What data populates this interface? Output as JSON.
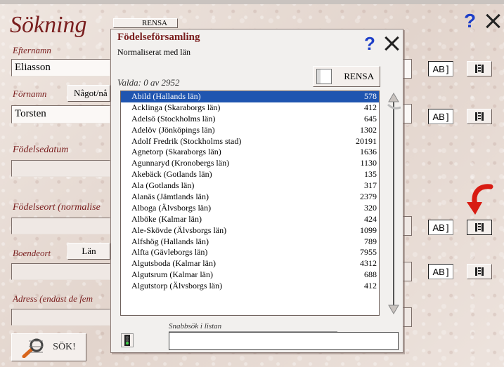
{
  "window": {
    "title": "Sökning"
  },
  "form": {
    "lastname_label": "Efternamn",
    "lastname_value": "Eliasson",
    "firstname_label": "Förnamn",
    "firstname_mode": "Något/nå",
    "firstname_value": "Torsten",
    "birthdate_label": "Födelsedatum",
    "birthplace_label": "Födelseort (normalise",
    "residence_label": "Boendeort",
    "residence_scope": "Län",
    "address_label": "Adress (endast de fem",
    "clear_partial": "RENSA",
    "ab_label": "AB",
    "search_label": "SÖK!"
  },
  "dialog": {
    "title": "Födelseförsamling",
    "subtitle": "Normaliserat med län",
    "selected_count": "Valda: 0 av 2952",
    "clear_label": "RENSA",
    "quicksearch_label": "Snabbsök i listan",
    "quicksearch_value": "",
    "items": [
      {
        "name": "Abild (Hallands län)",
        "count": "578"
      },
      {
        "name": "Acklinga (Skaraborgs län)",
        "count": "412"
      },
      {
        "name": "Adelsö (Stockholms län)",
        "count": "645"
      },
      {
        "name": "Adelöv (Jönköpings län)",
        "count": "1302"
      },
      {
        "name": "Adolf Fredrik (Stockholms stad)",
        "count": "20191"
      },
      {
        "name": "Agnetorp (Skaraborgs län)",
        "count": "1636"
      },
      {
        "name": "Agunnaryd (Kronobergs län)",
        "count": "1130"
      },
      {
        "name": "Akebäck (Gotlands län)",
        "count": "135"
      },
      {
        "name": "Ala (Gotlands län)",
        "count": "317"
      },
      {
        "name": "Alanäs (Jämtlands län)",
        "count": "2379"
      },
      {
        "name": "Alboga (Älvsborgs län)",
        "count": "320"
      },
      {
        "name": "Alböke (Kalmar län)",
        "count": "424"
      },
      {
        "name": "Ale-Skövde (Älvsborgs län)",
        "count": "1099"
      },
      {
        "name": "Alfshög (Hallands län)",
        "count": "789"
      },
      {
        "name": "Alfta (Gävleborgs län)",
        "count": "7955"
      },
      {
        "name": "Algutsboda (Kalmar län)",
        "count": "4312"
      },
      {
        "name": "Algutsrum (Kalmar län)",
        "count": "688"
      },
      {
        "name": "Algutstorp (Älvsborgs län)",
        "count": "412"
      }
    ]
  },
  "colors": {
    "accent": "#1f55b0",
    "title": "#7a1f1f",
    "help": "#1e3fc8",
    "arrow": "#d81b12"
  },
  "icons": {
    "help": "question-icon",
    "close": "close-icon",
    "list": "list-icon",
    "search": "search-magnifier-icon",
    "arrow": "red-arrow-icon",
    "traffic": "traffic-light-icon"
  }
}
